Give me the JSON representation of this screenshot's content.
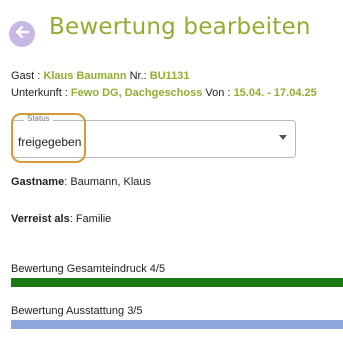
{
  "header": {
    "title": "Bewertung bearbeiten"
  },
  "booking": {
    "guest_label": "Gast : ",
    "guest_name": "Klaus Baumann",
    "nr_label": " Nr.: ",
    "nr_value": "BU1131",
    "accommodation_label": "Unterkunft : ",
    "accommodation_value": "Fewo DG, Dachgeschoss",
    "from_label": " Von : ",
    "date_range": "15.04. - 17.04.25"
  },
  "status": {
    "label": "Status",
    "value": "freigegeben"
  },
  "details": {
    "guestname_label": "Gastname",
    "guestname_value": ": Baumann, Klaus",
    "travels_as_label": "Verreist als",
    "travels_as_value": ": Familie"
  },
  "ratings": [
    {
      "label": "Bewertung Gesamteindruck 4/5",
      "fill_fraction": 1.0,
      "color": "#1c7a12"
    },
    {
      "label": "Bewertung Ausstattung 3/5",
      "fill_fraction": 1.0,
      "color": "#8fa8dc"
    }
  ],
  "colors": {
    "accent": "#8fae2f",
    "focus": "#d39a3a",
    "back_button": "#c8b7e4"
  }
}
